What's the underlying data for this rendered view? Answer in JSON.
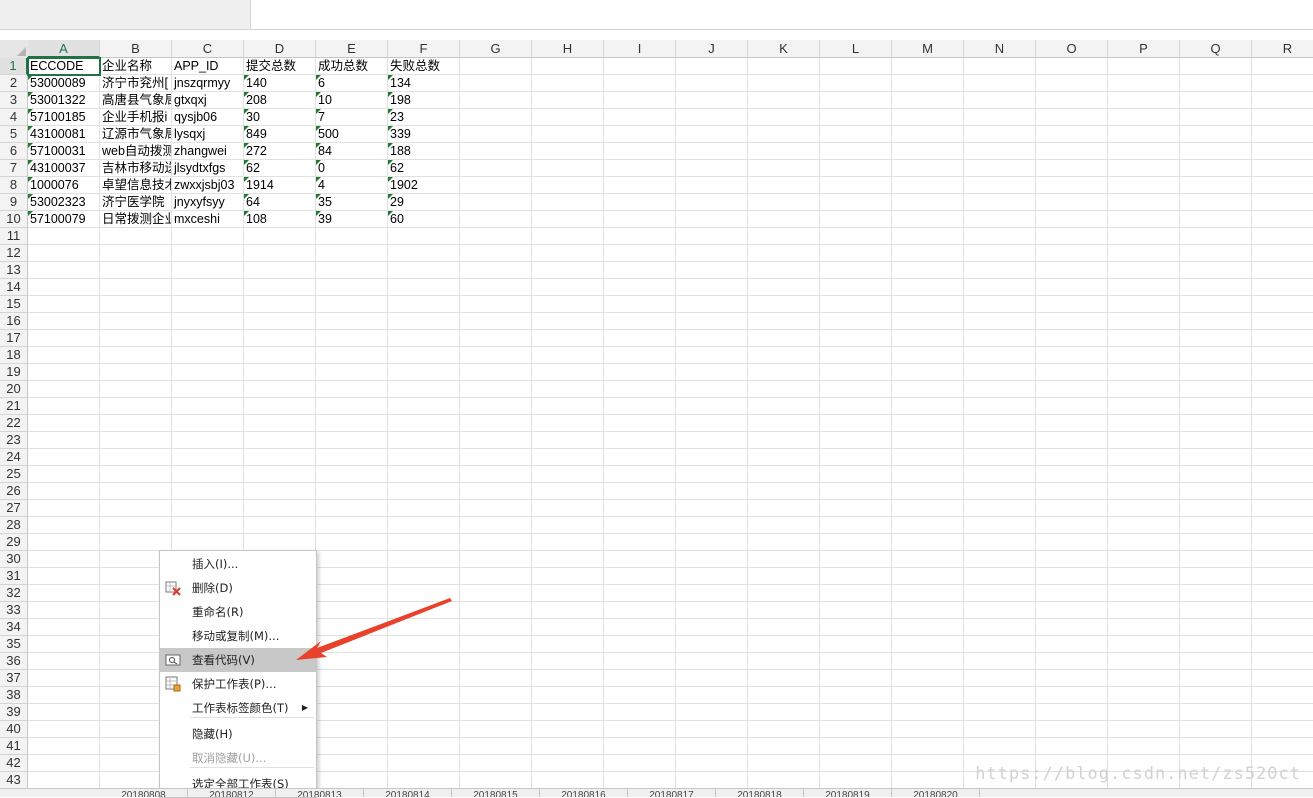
{
  "columns": [
    "A",
    "B",
    "C",
    "D",
    "E",
    "F",
    "G",
    "H",
    "I",
    "J",
    "K",
    "L",
    "M",
    "N",
    "O",
    "P",
    "Q",
    "R"
  ],
  "rows": [
    "1",
    "2",
    "3",
    "4",
    "5",
    "6",
    "7",
    "8",
    "9",
    "10",
    "11",
    "12",
    "13",
    "14",
    "15",
    "16",
    "17",
    "18",
    "19",
    "20",
    "21",
    "22",
    "23",
    "24",
    "25",
    "26",
    "27",
    "28",
    "29",
    "30",
    "31",
    "32",
    "33",
    "34",
    "35",
    "36",
    "37",
    "38",
    "39",
    "40",
    "41",
    "42",
    "43"
  ],
  "table": {
    "headers": [
      "ECCODE",
      "企业名称",
      "APP_ID",
      "提交总数",
      "成功总数",
      "失败总数"
    ],
    "data": [
      [
        "53000089",
        "济宁市兖州[",
        "jnszqrmyy",
        "140",
        "6",
        "134"
      ],
      [
        "53001322",
        "高唐县气象局",
        "gtxqxj",
        "208",
        "10",
        "198"
      ],
      [
        "57100185",
        "企业手机报i",
        "qysjb06",
        "30",
        "7",
        "23"
      ],
      [
        "43100081",
        "辽源市气象局",
        "lysqxj",
        "849",
        "500",
        "339"
      ],
      [
        "57100031",
        "web自动拨测",
        "zhangwei",
        "272",
        "84",
        "188"
      ],
      [
        "43100037",
        "吉林市移动送",
        "jlsydtxfgs",
        "62",
        "0",
        "62"
      ],
      [
        "1000076",
        "卓望信息技术",
        "zwxxjsbj03",
        "1914",
        "4",
        "1902"
      ],
      [
        "53002323",
        "济宁医学院",
        "jnyxyfsyy",
        "64",
        "35",
        "29"
      ],
      [
        "57100079",
        "日常拨测企业",
        "mxceshi",
        "108",
        "39",
        "60"
      ]
    ]
  },
  "context_menu": {
    "items": [
      {
        "label": "插入(I)...",
        "icon": "",
        "disabled": false
      },
      {
        "label": "删除(D)",
        "icon": "delete-sheet-icon",
        "disabled": false
      },
      {
        "label": "重命名(R)",
        "icon": "",
        "disabled": false
      },
      {
        "label": "移动或复制(M)...",
        "icon": "",
        "disabled": false
      },
      {
        "label": "查看代码(V)",
        "icon": "view-code-icon",
        "disabled": false,
        "highlighted": true
      },
      {
        "label": "保护工作表(P)...",
        "icon": "protect-sheet-icon",
        "disabled": false
      },
      {
        "label": "工作表标签颜色(T)",
        "icon": "",
        "disabled": false,
        "submenu": true
      },
      {
        "label": "隐藏(H)",
        "icon": "",
        "disabled": false
      },
      {
        "label": "取消隐藏(U)...",
        "icon": "",
        "disabled": true
      },
      {
        "label": "选定全部工作表(S)",
        "icon": "",
        "disabled": false
      }
    ]
  },
  "sheet_tabs": [
    "20180808",
    "20180812",
    "20180813",
    "20180814",
    "20180815",
    "20180816",
    "20180817",
    "20180818",
    "20180819",
    "20180820"
  ],
  "watermark": "https://blog.csdn.net/zs520ct",
  "colors": {
    "accent": "#217346",
    "highlight": "#c8c8c8",
    "arrow": "#e8412c",
    "error_triangle": "#1f7a32"
  }
}
